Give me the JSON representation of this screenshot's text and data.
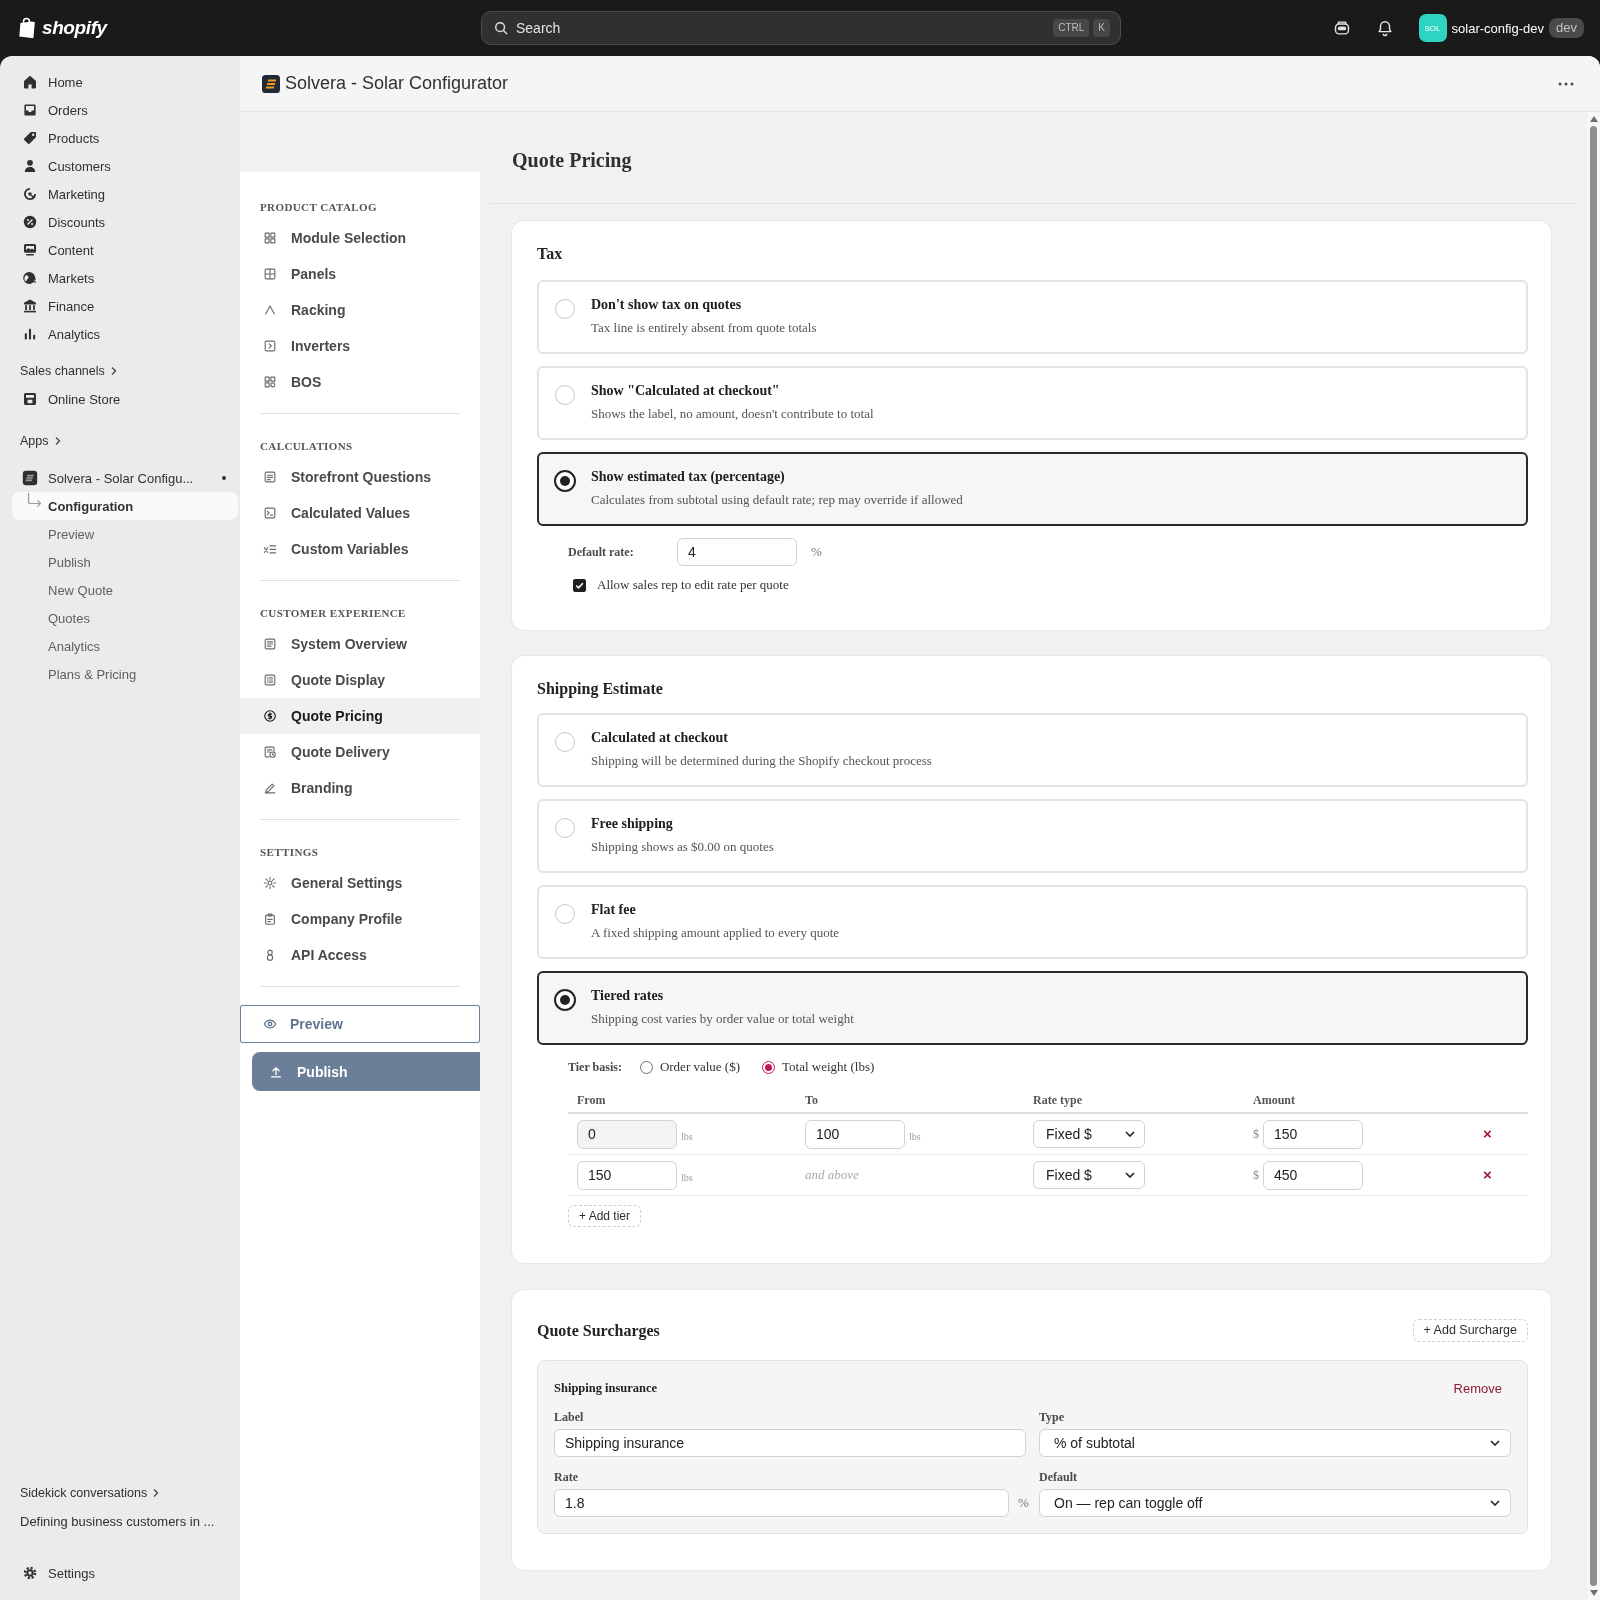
{
  "topbar": {
    "logo": "shopify",
    "search": {
      "placeholder": "Search",
      "shortcut": [
        "CTRL",
        "K"
      ]
    },
    "account": {
      "avatar": "SOL",
      "name": "solar-config-dev",
      "badge": "dev"
    }
  },
  "sidebar": {
    "items": [
      {
        "label": "Home",
        "selected": false
      },
      {
        "label": "Orders",
        "selected": false
      },
      {
        "label": "Products",
        "selected": false
      },
      {
        "label": "Customers",
        "selected": false
      },
      {
        "label": "Marketing",
        "selected": false
      },
      {
        "label": "Discounts",
        "selected": false
      },
      {
        "label": "Content",
        "selected": false
      },
      {
        "label": "Markets",
        "selected": false
      },
      {
        "label": "Finance",
        "selected": false
      },
      {
        "label": "Analytics",
        "selected": false
      }
    ],
    "sales_channels": {
      "heading": "Sales channels",
      "items": [
        {
          "label": "Online Store",
          "selected": false
        }
      ]
    },
    "apps": {
      "heading": "Apps",
      "items": [
        {
          "label": "Solvera - Solar Configu...",
          "children": [
            {
              "label": "Configuration",
              "selected": true
            },
            {
              "label": "Preview",
              "selected": false
            },
            {
              "label": "Publish",
              "selected": false
            },
            {
              "label": "New Quote",
              "selected": false
            },
            {
              "label": "Quotes",
              "selected": false
            },
            {
              "label": "Analytics",
              "selected": false
            },
            {
              "label": "Plans & Pricing",
              "selected": false
            }
          ]
        }
      ]
    },
    "sidekick": {
      "heading": "Sidekick conversations",
      "items": [
        {
          "label": "Defining business customers in ..."
        }
      ]
    },
    "settings": {
      "label": "Settings"
    }
  },
  "app_header": {
    "title": "Solvera - Solar Configurator"
  },
  "app_nav": {
    "sections": [
      {
        "heading": "PRODUCT CATALOG",
        "items": [
          {
            "label": "Module Selection",
            "selected": false
          },
          {
            "label": "Panels",
            "selected": false
          },
          {
            "label": "Racking",
            "selected": false
          },
          {
            "label": "Inverters",
            "selected": false
          },
          {
            "label": "BOS",
            "selected": false
          }
        ]
      },
      {
        "heading": "CALCULATIONS",
        "items": [
          {
            "label": "Storefront Questions",
            "selected": false
          },
          {
            "label": "Calculated Values",
            "selected": false
          },
          {
            "label": "Custom Variables",
            "selected": false
          }
        ]
      },
      {
        "heading": "CUSTOMER EXPERIENCE",
        "items": [
          {
            "label": "System Overview",
            "selected": false
          },
          {
            "label": "Quote Display",
            "selected": false
          },
          {
            "label": "Quote Pricing",
            "selected": true
          },
          {
            "label": "Quote Delivery",
            "selected": false
          },
          {
            "label": "Branding",
            "selected": false
          }
        ]
      },
      {
        "heading": "SETTINGS",
        "items": [
          {
            "label": "General Settings",
            "selected": false
          },
          {
            "label": "Company Profile",
            "selected": false
          },
          {
            "label": "API Access",
            "selected": false
          }
        ]
      }
    ],
    "buttons": [
      {
        "kind": "outline",
        "label": "Preview"
      },
      {
        "kind": "primary",
        "label": "Publish"
      }
    ]
  },
  "page": {
    "title": "Quote Pricing"
  },
  "tax": {
    "title": "Tax",
    "options": [
      {
        "title": "Don't show tax on quotes",
        "description": "Tax line is entirely absent from quote totals",
        "selected": false
      },
      {
        "title": "Show \"Calculated at checkout\"",
        "description": "Shows the label, no amount, doesn't contribute to total",
        "selected": false
      },
      {
        "title": "Show estimated tax (percentage)",
        "description": "Calculates from subtotal using default rate; rep may override if allowed",
        "selected": true
      }
    ],
    "default_rate": {
      "label": "Default rate:",
      "value": "4",
      "suffix": "%"
    },
    "allow_edit": {
      "label": "Allow sales rep to edit rate per quote",
      "checked": true
    }
  },
  "shipping": {
    "title": "Shipping Estimate",
    "options": [
      {
        "title": "Calculated at checkout",
        "description": "Shipping will be determined during the Shopify checkout process",
        "selected": false
      },
      {
        "title": "Free shipping",
        "description": "Shipping shows as $0.00 on quotes",
        "selected": false
      },
      {
        "title": "Flat fee",
        "description": "A fixed shipping amount applied to every quote",
        "selected": false
      },
      {
        "title": "Tiered rates",
        "description": "Shipping cost varies by order value or total weight",
        "selected": true
      }
    ],
    "tier_basis": {
      "label": "Tier basis:",
      "options": [
        {
          "label": "Order value ($)",
          "selected": false
        },
        {
          "label": "Total weight (lbs)",
          "selected": true
        }
      ]
    },
    "tiers": {
      "columns": [
        "From",
        "To",
        "Rate type",
        "Amount"
      ],
      "rows": [
        {
          "from": {
            "value": "0",
            "unit": "lbs",
            "disabled": true
          },
          "to": {
            "kind": "field",
            "value": "100",
            "unit": "lbs"
          },
          "rate_type": "Fixed $",
          "currency": "$",
          "amount": "150",
          "remove": "×"
        },
        {
          "from": {
            "value": "150",
            "unit": "lbs",
            "disabled": false
          },
          "to": {
            "kind": "text",
            "text": "and above"
          },
          "rate_type": "Fixed $",
          "currency": "$",
          "amount": "450",
          "remove": "×"
        }
      ]
    },
    "add_button": "+ Add tier"
  },
  "surcharges": {
    "title": "Quote Surcharges",
    "add_button": "+ Add Surcharge",
    "items": [
      {
        "title": "Shipping insurance",
        "remove": "Remove",
        "fields": [
          {
            "kind": "input",
            "label": "Label",
            "value": "Shipping insurance"
          },
          {
            "kind": "select",
            "label": "Type",
            "value": "% of subtotal"
          },
          {
            "kind": "input",
            "label": "Rate",
            "value": "1.8",
            "suffix": "%"
          },
          {
            "kind": "select",
            "label": "Default",
            "value": "On — rep can toggle off"
          }
        ]
      }
    ]
  }
}
